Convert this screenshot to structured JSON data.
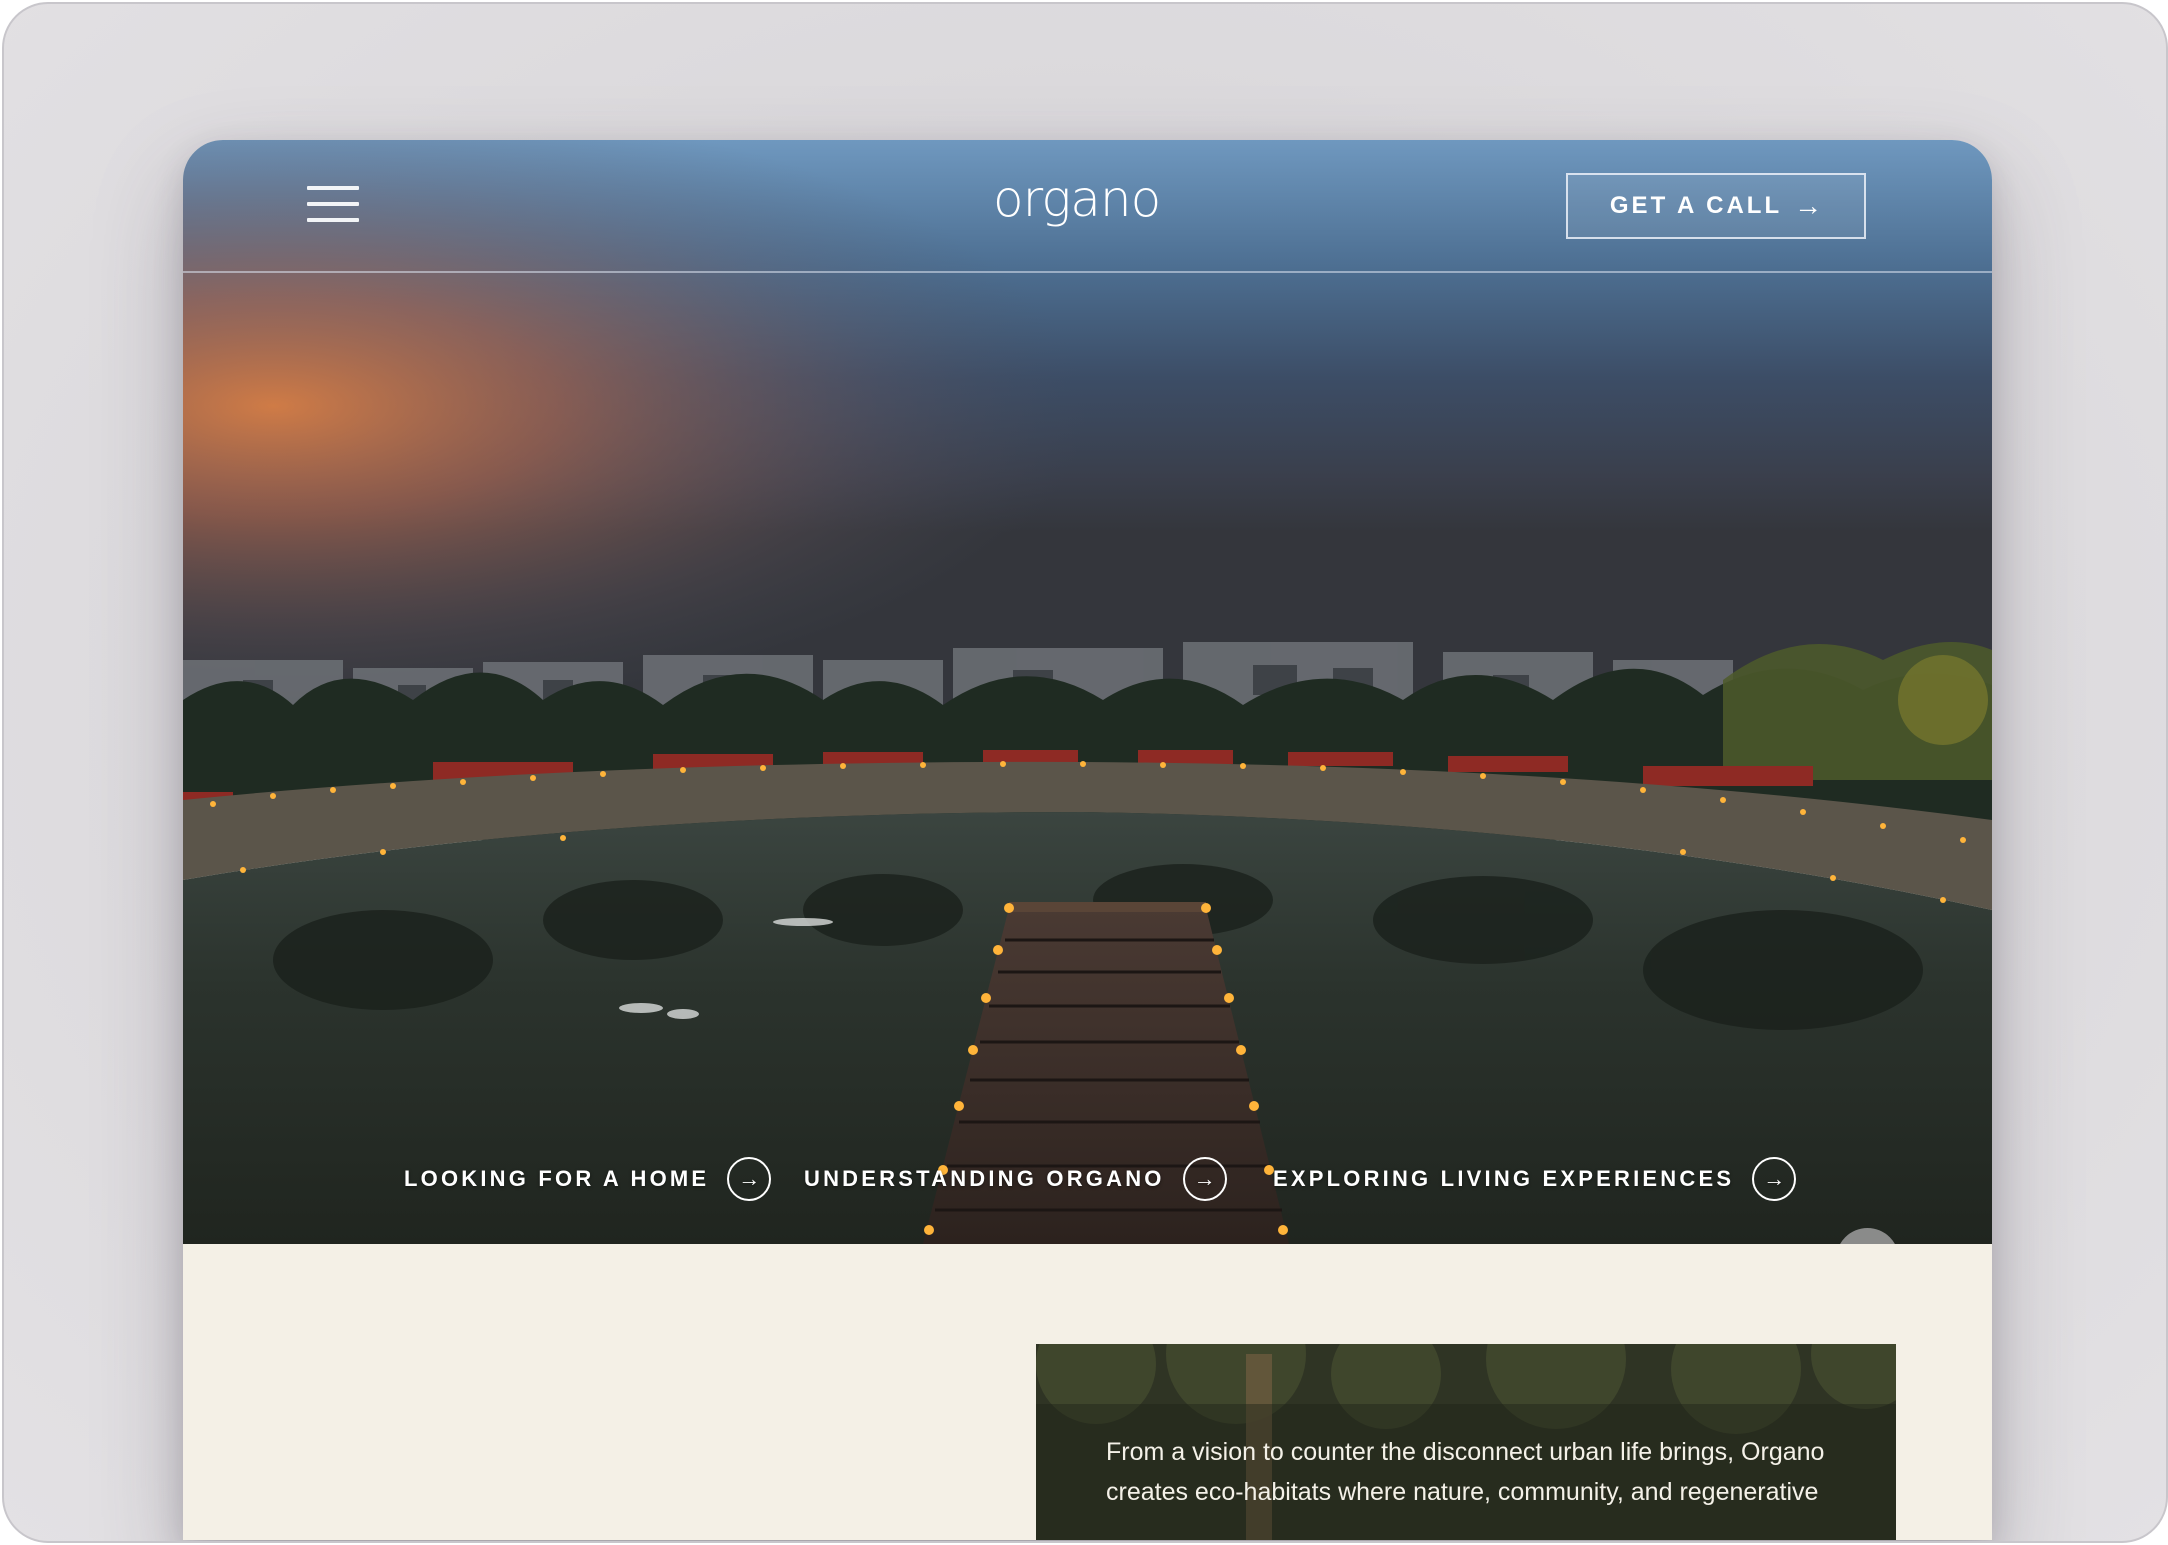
{
  "header": {
    "logo_text": "organo",
    "cta_label": "GET A CALL",
    "cta_icon": "arrow-right-icon",
    "menu_icon": "hamburger-menu-icon"
  },
  "hero": {
    "links": [
      {
        "label": "LOOKING FOR A HOME",
        "icon": "circle-arrow-right-icon"
      },
      {
        "label": "UNDERSTANDING ORGANO",
        "icon": "circle-arrow-right-icon"
      },
      {
        "label": "EXPLORING LIVING EXPERIENCES",
        "icon": "circle-arrow-right-icon"
      }
    ],
    "scroll_top_icon": "arrow-up-icon"
  },
  "intro": {
    "text": "From a vision to counter the disconnect urban life brings, Organo creates eco-habitats where nature, community, and regenerative"
  },
  "colors": {
    "background_cream": "#f4f0e6",
    "sky_top": "#5d86ad",
    "sunset": "#c77a4c",
    "lights": "#ffb43a"
  }
}
